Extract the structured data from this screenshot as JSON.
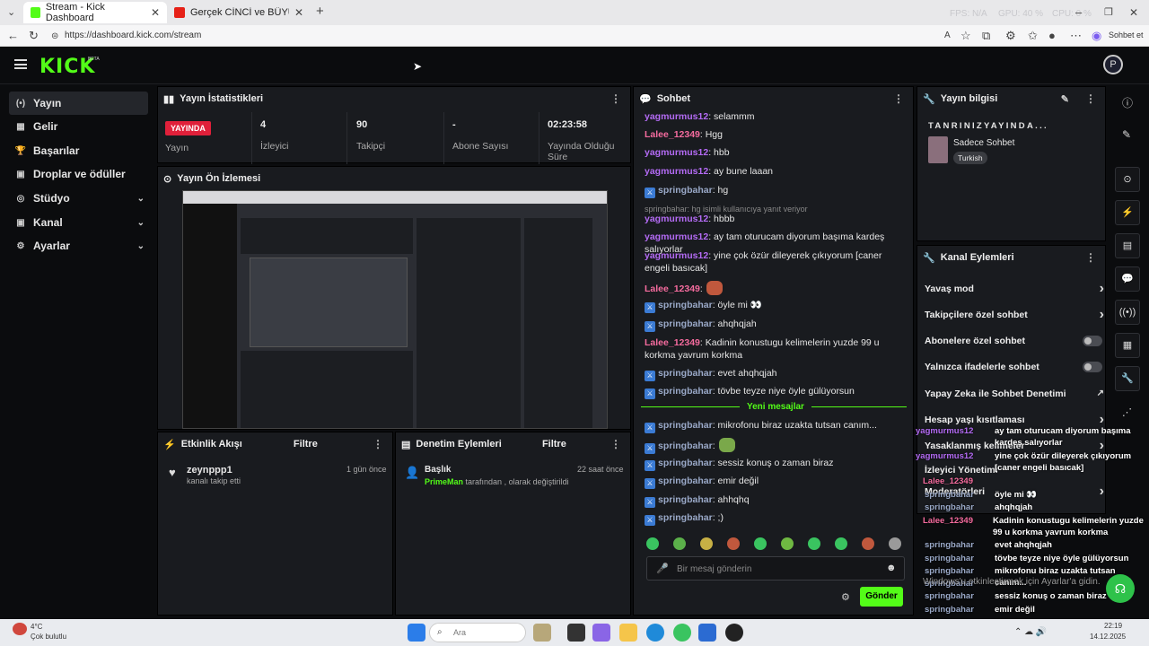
{
  "browser": {
    "tabs": [
      {
        "title": "Stream - Kick Dashboard",
        "active": true
      },
      {
        "title": "Gerçek CİNCİ ve BÜYÜCÜ KADIN",
        "active": false
      }
    ],
    "url": "https://dashboard.kick.com/stream",
    "hud": {
      "fps": "FPS: N/A",
      "gpu": "GPU: 40 %",
      "cpu": "CPU: 0 %"
    },
    "chat_button": "Sohbet et"
  },
  "header": {
    "logo": "KICK",
    "beta": "BETA",
    "avatar_initial": "P"
  },
  "sidebar": {
    "items": [
      {
        "label": "Yayın",
        "icon": "(•)",
        "active": true
      },
      {
        "label": "Gelir",
        "icon": "▦"
      },
      {
        "label": "Başarılar",
        "icon": "🏆"
      },
      {
        "label": "Droplar ve ödüller",
        "icon": "▣"
      },
      {
        "label": "Stüdyo",
        "icon": "◎",
        "chevron": true
      },
      {
        "label": "Kanal",
        "icon": "▣",
        "chevron": true
      },
      {
        "label": "Ayarlar",
        "icon": "⚙",
        "chevron": true
      }
    ]
  },
  "stats": {
    "title": "Yayın İstatistikleri",
    "live_badge": "YAYINDA",
    "status_label": "Yayın",
    "viewers": {
      "value": "4",
      "label": "İzleyici"
    },
    "followers": {
      "value": "90",
      "label": "Takipçi"
    },
    "subs": {
      "value": "-",
      "label": "Abone Sayısı"
    },
    "uptime": {
      "value": "02:23:58",
      "label": "Yayında Olduğu Süre"
    }
  },
  "preview": {
    "title": "Yayın Ön İzlemesi"
  },
  "activity": {
    "title": "Etkinlik Akışı",
    "filter": "Filtre",
    "items": [
      {
        "user": "zeynppp1",
        "text": "kanalı takip etti",
        "time": "1 gün önce"
      }
    ]
  },
  "moderation": {
    "title": "Denetim Eylemleri",
    "filter": "Filtre",
    "items": [
      {
        "title": "Başlık",
        "user": "PrimeMan",
        "text": "tarafından , olarak değiştirildi",
        "time": "22 saat önce"
      }
    ]
  },
  "chat": {
    "title": "Sohbet",
    "messages": [
      {
        "user": "yagmurmus12",
        "text": ": selammm",
        "cls": "u1"
      },
      {
        "user": "Lalee_12349",
        "text": ": Hgg",
        "cls": "u2"
      },
      {
        "user": "yagmurmus12",
        "text": ": hbb",
        "cls": "u1"
      },
      {
        "user": "yagmurmus12",
        "text": ": ay bune laaan",
        "cls": "u1"
      },
      {
        "user": "springbahar",
        "text": ": hg",
        "cls": "u3",
        "badge": true
      },
      {
        "reply": "springbahar: hg isimli kullanıcıya yanıt veriyor"
      },
      {
        "user": "yagmurmus12",
        "text": ": hbbb",
        "cls": "u1"
      },
      {
        "user": "yagmurmus12",
        "text": ": ay tam oturucam diyorum başıma kardeş salıyorlar",
        "cls": "u1"
      },
      {
        "user": "yagmurmus12",
        "text": ": yine çok özür dileyerek çıkıyorum [caner engeli basıcak]",
        "cls": "u1"
      },
      {
        "user": "Lalee_12349",
        "text": ":",
        "cls": "u2",
        "emote": true
      },
      {
        "user": "springbahar",
        "text": ": öyle mi 👀",
        "cls": "u3",
        "badge": true
      },
      {
        "user": "springbahar",
        "text": ": ahqhqjah",
        "cls": "u3",
        "badge": true
      },
      {
        "user": "Lalee_12349",
        "text": ": Kadinin konustugu kelimelerin yuzde 99 u korkma yavrum korkma",
        "cls": "u2"
      },
      {
        "user": "springbahar",
        "text": ": evet ahqhqjah",
        "cls": "u3",
        "badge": true
      },
      {
        "user": "springbahar",
        "text": ": tövbe teyze niye öyle gülüyorsun",
        "cls": "u3",
        "badge": true
      }
    ],
    "new_messages": "Yeni mesajlar",
    "new": [
      {
        "user": "springbahar",
        "text": ": mikrofonu biraz uzakta tutsan canım...",
        "cls": "u3",
        "badge": true
      },
      {
        "user": "springbahar",
        "text": ":",
        "cls": "u3",
        "badge": true,
        "emote": true
      },
      {
        "user": "springbahar",
        "text": ": sessiz konuş o zaman biraz",
        "cls": "u3",
        "badge": true
      },
      {
        "user": "springbahar",
        "text": ": emir değil",
        "cls": "u3",
        "badge": true
      },
      {
        "user": "springbahar",
        "text": ": ahhqhq",
        "cls": "u3",
        "badge": true
      },
      {
        "user": "springbahar",
        "text": ": ;)",
        "cls": "u3",
        "badge": true
      }
    ],
    "input_placeholder": "Bir mesaj gönderin",
    "send": "Gönder"
  },
  "stream_info": {
    "title": "Yayın bilgisi",
    "stream_title": "TANRINIZYAYINDA...",
    "category": "Sadece Sohbet",
    "tag": "Turkish"
  },
  "channel_actions": {
    "title": "Kanal Eylemleri",
    "items": [
      {
        "label": "Yavaş mod",
        "type": "chevron"
      },
      {
        "label": "Takipçilere özel sohbet",
        "type": "chevron"
      },
      {
        "label": "Abonelere özel sohbet",
        "type": "toggle"
      },
      {
        "label": "Yalnızca ifadelerle sohbet",
        "type": "toggle"
      },
      {
        "label": "Yapay Zeka ile Sohbet Denetimi",
        "type": "external"
      },
      {
        "label": "Hesap yaşı kısıtlaması",
        "type": "chevron"
      },
      {
        "label": "Yasaklanmış kelimeler",
        "type": "chevron"
      },
      {
        "label": "İzleyici Yönetimi",
        "type": "none"
      },
      {
        "label": "Moderatörleri",
        "type": "chevron"
      }
    ]
  },
  "overlay": {
    "lines": [
      {
        "user": "yagmurmus12",
        "text": "ay tam oturucam diyorum başıma kardeş salıyorlar",
        "color": "#b46bf5"
      },
      {
        "user": "yagmurmus12",
        "text": "yine çok özür dileyerek çıkıyorum [caner engeli basıcak]",
        "color": "#b46bf5"
      },
      {
        "user": "Lalee_12349",
        "text": "",
        "color": "#f56b9e"
      },
      {
        "user": "springbahar",
        "text": "öyle mi 👀",
        "color": "#9aa9c8"
      },
      {
        "user": "springbahar",
        "text": "ahqhqjah",
        "color": "#9aa9c8"
      },
      {
        "user": "Lalee_12349",
        "text": "Kadinin konustugu kelimelerin yuzde 99 u korkma yavrum korkma",
        "color": "#f56b9e"
      },
      {
        "user": "springbahar",
        "text": "evet ahqhqjah",
        "color": "#9aa9c8"
      },
      {
        "user": "springbahar",
        "text": "tövbe teyze niye öyle gülüyorsun",
        "color": "#9aa9c8"
      },
      {
        "user": "springbahar",
        "text": "mikrofonu biraz uzakta tutsan canım...",
        "color": "#9aa9c8"
      },
      {
        "user": "springbahar",
        "text": "",
        "color": "#9aa9c8"
      },
      {
        "user": "springbahar",
        "text": "sessiz konuş o zaman biraz",
        "color": "#9aa9c8"
      },
      {
        "user": "springbahar",
        "text": "emir değil",
        "color": "#9aa9c8"
      },
      {
        "user": "springbahar",
        "text": "ahhqhq",
        "color": "#9aa9c8"
      },
      {
        "user": "springbahar",
        "text": ";)",
        "color": "#9aa9c8"
      }
    ],
    "windows_notice": "Windows'u etkinleştirmek için Ayarlar'a gidin."
  },
  "taskbar": {
    "weather_temp": "4°C",
    "weather_desc": "Çok bulutlu",
    "search": "Ara",
    "time": "22:19",
    "date": "14.12.2025"
  },
  "colors": {
    "kick_green": "#53fc18",
    "live_red": "#e0203a",
    "bg": "#0b0c0e",
    "panel": "#191b1f"
  }
}
